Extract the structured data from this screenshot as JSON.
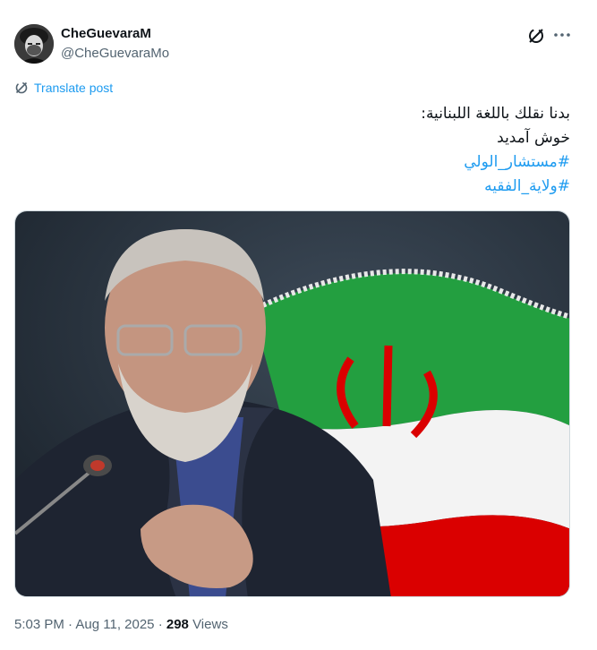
{
  "author": {
    "display_name": "CheGuevaraM",
    "handle": "@CheGuevaraMo"
  },
  "actions": {
    "grok_icon": "grok-icon",
    "more_icon": "more-icon"
  },
  "translate_label": "Translate post",
  "tweet": {
    "lines": [
      "بدنا نقلك باللغة اللبنانية:",
      "خوش آمدید"
    ],
    "hashtags": [
      "#مستشار_الولي",
      "#ولاية_الفقيه"
    ]
  },
  "meta": {
    "time": "5:03 PM",
    "separator": " · ",
    "date": "Aug 11, 2025",
    "separator2": " · ",
    "views_count": "298",
    "views_label": " Views"
  },
  "colors": {
    "accent": "#1d9bf0",
    "secondary_text": "#536471",
    "flag_green": "#239f40",
    "flag_red": "#da0000"
  }
}
